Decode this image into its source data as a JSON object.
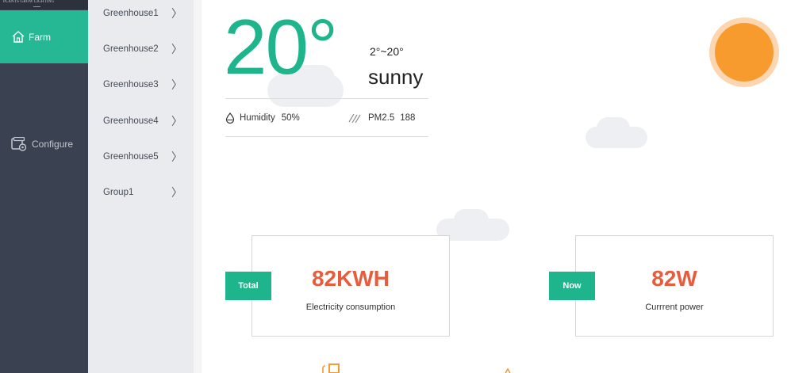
{
  "nav": {
    "logo_text": "PLANTS GROW LIGHTING",
    "logo_sub": "▬▬▬",
    "farm_label": "Farm",
    "configure_label": "Configure"
  },
  "submenu": {
    "items": [
      {
        "label": "Greenhouse1"
      },
      {
        "label": "Greenhouse2"
      },
      {
        "label": "Greenhouse3"
      },
      {
        "label": "Greenhouse4"
      },
      {
        "label": "Greenhouse5"
      },
      {
        "label": "Group1"
      }
    ],
    "chevron": "〉"
  },
  "weather": {
    "temperature": "20°",
    "range": "2°~20°",
    "condition": "sunny",
    "humidity_label": "Humidity",
    "humidity_value": "50%",
    "pm_label": "PM2.5",
    "pm_value": "188"
  },
  "cards": {
    "total": {
      "tag": "Total",
      "value": "82KWH",
      "label": "Electricity consumption"
    },
    "now": {
      "tag": "Now",
      "value": "82W",
      "label": "Currrent power"
    }
  },
  "colors": {
    "accent": "#1fb58c",
    "value_red": "#e85c3e",
    "sun": "#f79b2e",
    "nav_bg": "#3a4150"
  }
}
